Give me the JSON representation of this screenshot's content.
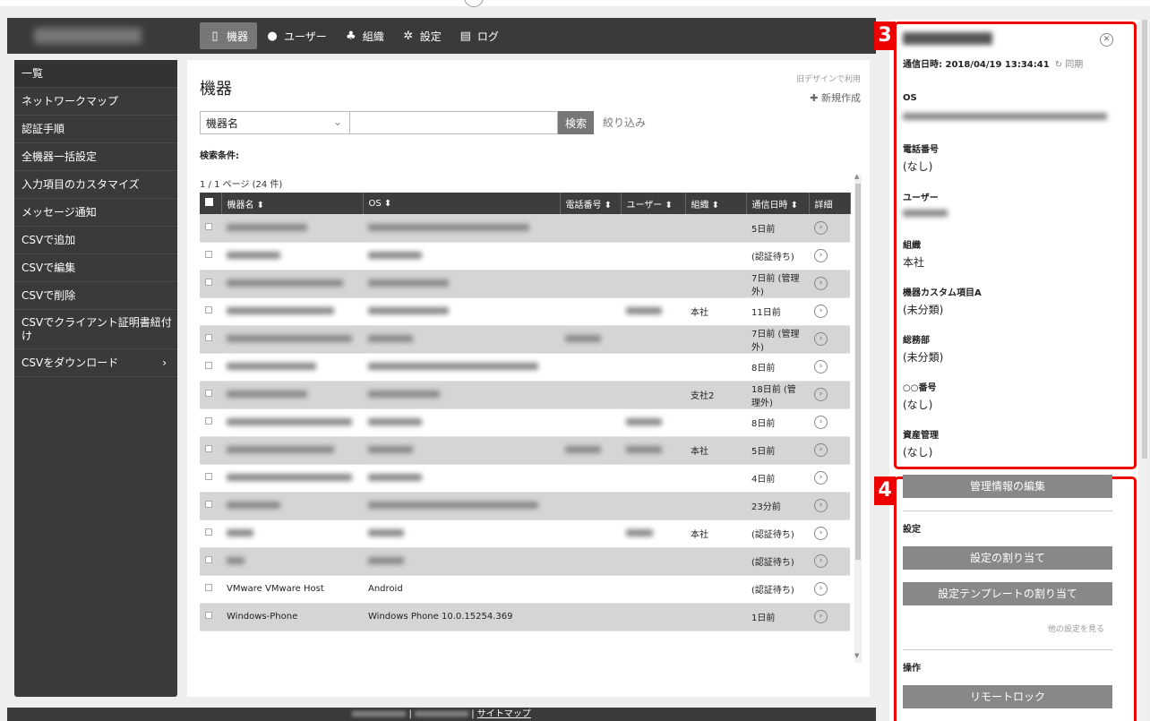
{
  "nav": {
    "devices": "機器",
    "users": "ユーザー",
    "orgs": "組織",
    "settings": "設定",
    "logs": "ログ"
  },
  "sidebar": {
    "items": [
      {
        "label": "一覧"
      },
      {
        "label": "ネットワークマップ"
      },
      {
        "label": "認証手順"
      },
      {
        "label": "全機器一括設定"
      },
      {
        "label": "入力項目のカスタマイズ"
      },
      {
        "label": "メッセージ通知"
      },
      {
        "label": "CSVで追加"
      },
      {
        "label": "CSVで編集"
      },
      {
        "label": "CSVで削除"
      },
      {
        "label": "CSVでクライアント証明書紐付け"
      },
      {
        "label": "CSVをダウンロード"
      }
    ],
    "arrow": "›"
  },
  "main": {
    "title": "機器",
    "old_design": "旧デザインで利用",
    "new_create": "✚ 新規作成",
    "search_select": "機器名",
    "search_button": "検索",
    "filter_link": "絞り込み",
    "conditions_label": "検索条件:",
    "page_info": "1 / 1 ページ (24 件)"
  },
  "table": {
    "headers": {
      "name": "機器名 ⬍",
      "os": "OS ⬍",
      "phone": "電話番号 ⬍",
      "user": "ユーザー ⬍",
      "org": "組織 ⬍",
      "comm": "通信日時 ⬍",
      "detail": "詳細"
    },
    "rows": [
      {
        "org": "",
        "comm": "5日前"
      },
      {
        "org": "",
        "comm": "(認証待ち)"
      },
      {
        "org": "",
        "comm": "7日前 (管理外)"
      },
      {
        "org": "本社",
        "comm": "11日前"
      },
      {
        "org": "",
        "comm": "7日前 (管理外)"
      },
      {
        "org": "",
        "comm": "8日前"
      },
      {
        "org": "支社2",
        "comm": "18日前 (管理外)"
      },
      {
        "org": "",
        "comm": "8日前"
      },
      {
        "org": "本社",
        "comm": "5日前"
      },
      {
        "org": "",
        "comm": "4日前"
      },
      {
        "org": "",
        "comm": "23分前"
      },
      {
        "org": "本社",
        "comm": "(認証待ち)"
      },
      {
        "org": "",
        "comm": "(認証待ち)"
      },
      {
        "name": "VMware VMware Host",
        "os": "Android",
        "org": "",
        "comm": "(認証待ち)"
      },
      {
        "name": "Windows-Phone",
        "os": "Windows Phone 10.0.15254.369",
        "org": "",
        "comm": "1日前"
      }
    ]
  },
  "footer": {
    "sitemap": "サイトマップ",
    "sep": "|"
  },
  "panel": {
    "badge3": "3",
    "badge4": "4",
    "comm_label": "通信日時: 2018/04/19 13:34:41",
    "sync": "↻ 同期",
    "fields": [
      {
        "label": "OS",
        "value": ""
      },
      {
        "label": "電話番号",
        "value": "(なし)"
      },
      {
        "label": "ユーザー",
        "value": ""
      },
      {
        "label": "組織",
        "value": "本社"
      },
      {
        "label": "機器カスタム項目A",
        "value": "(未分類)"
      },
      {
        "label": "総務部",
        "value": "(未分類)"
      },
      {
        "label": "○○番号",
        "value": "(なし)"
      },
      {
        "label": "資産管理",
        "value": "(なし)"
      }
    ],
    "edit_button": "管理情報の編集",
    "settings_section": "設定",
    "assign_settings": "設定の割り当て",
    "assign_template": "設定テンプレートの割り当て",
    "more_settings": "他の設定を見る",
    "operations_section": "操作",
    "remote_lock": "リモートロック"
  }
}
